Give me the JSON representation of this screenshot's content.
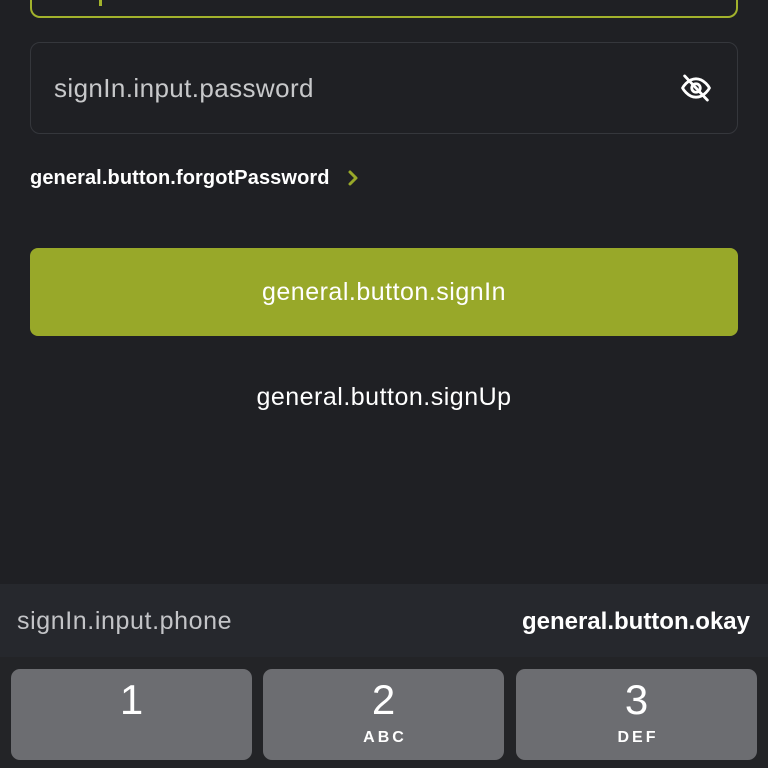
{
  "colors": {
    "background": "#1f2024",
    "accent": "#98a829",
    "field_border": "#35373c",
    "toolbar": "#26282d",
    "keyboard": "#232427",
    "key": "#6c6d71",
    "text": "#ffffff",
    "placeholder": "#c7c8ca"
  },
  "password_field": {
    "placeholder": "signIn.input.password",
    "visibility_icon": "eye-slash-icon"
  },
  "forgot_password": {
    "label": "general.button.forgotPassword",
    "icon": "chevron-right-icon"
  },
  "sign_in_button": {
    "label": "general.button.signIn"
  },
  "sign_up_button": {
    "label": "general.button.signUp"
  },
  "keyboard_toolbar": {
    "field_label": "signIn.input.phone",
    "done_label": "general.button.okay"
  },
  "keypad": {
    "keys": [
      {
        "digit": "1"
      },
      {
        "digit": "2",
        "letters": "ABC"
      },
      {
        "digit": "3",
        "letters": "DEF"
      }
    ]
  }
}
